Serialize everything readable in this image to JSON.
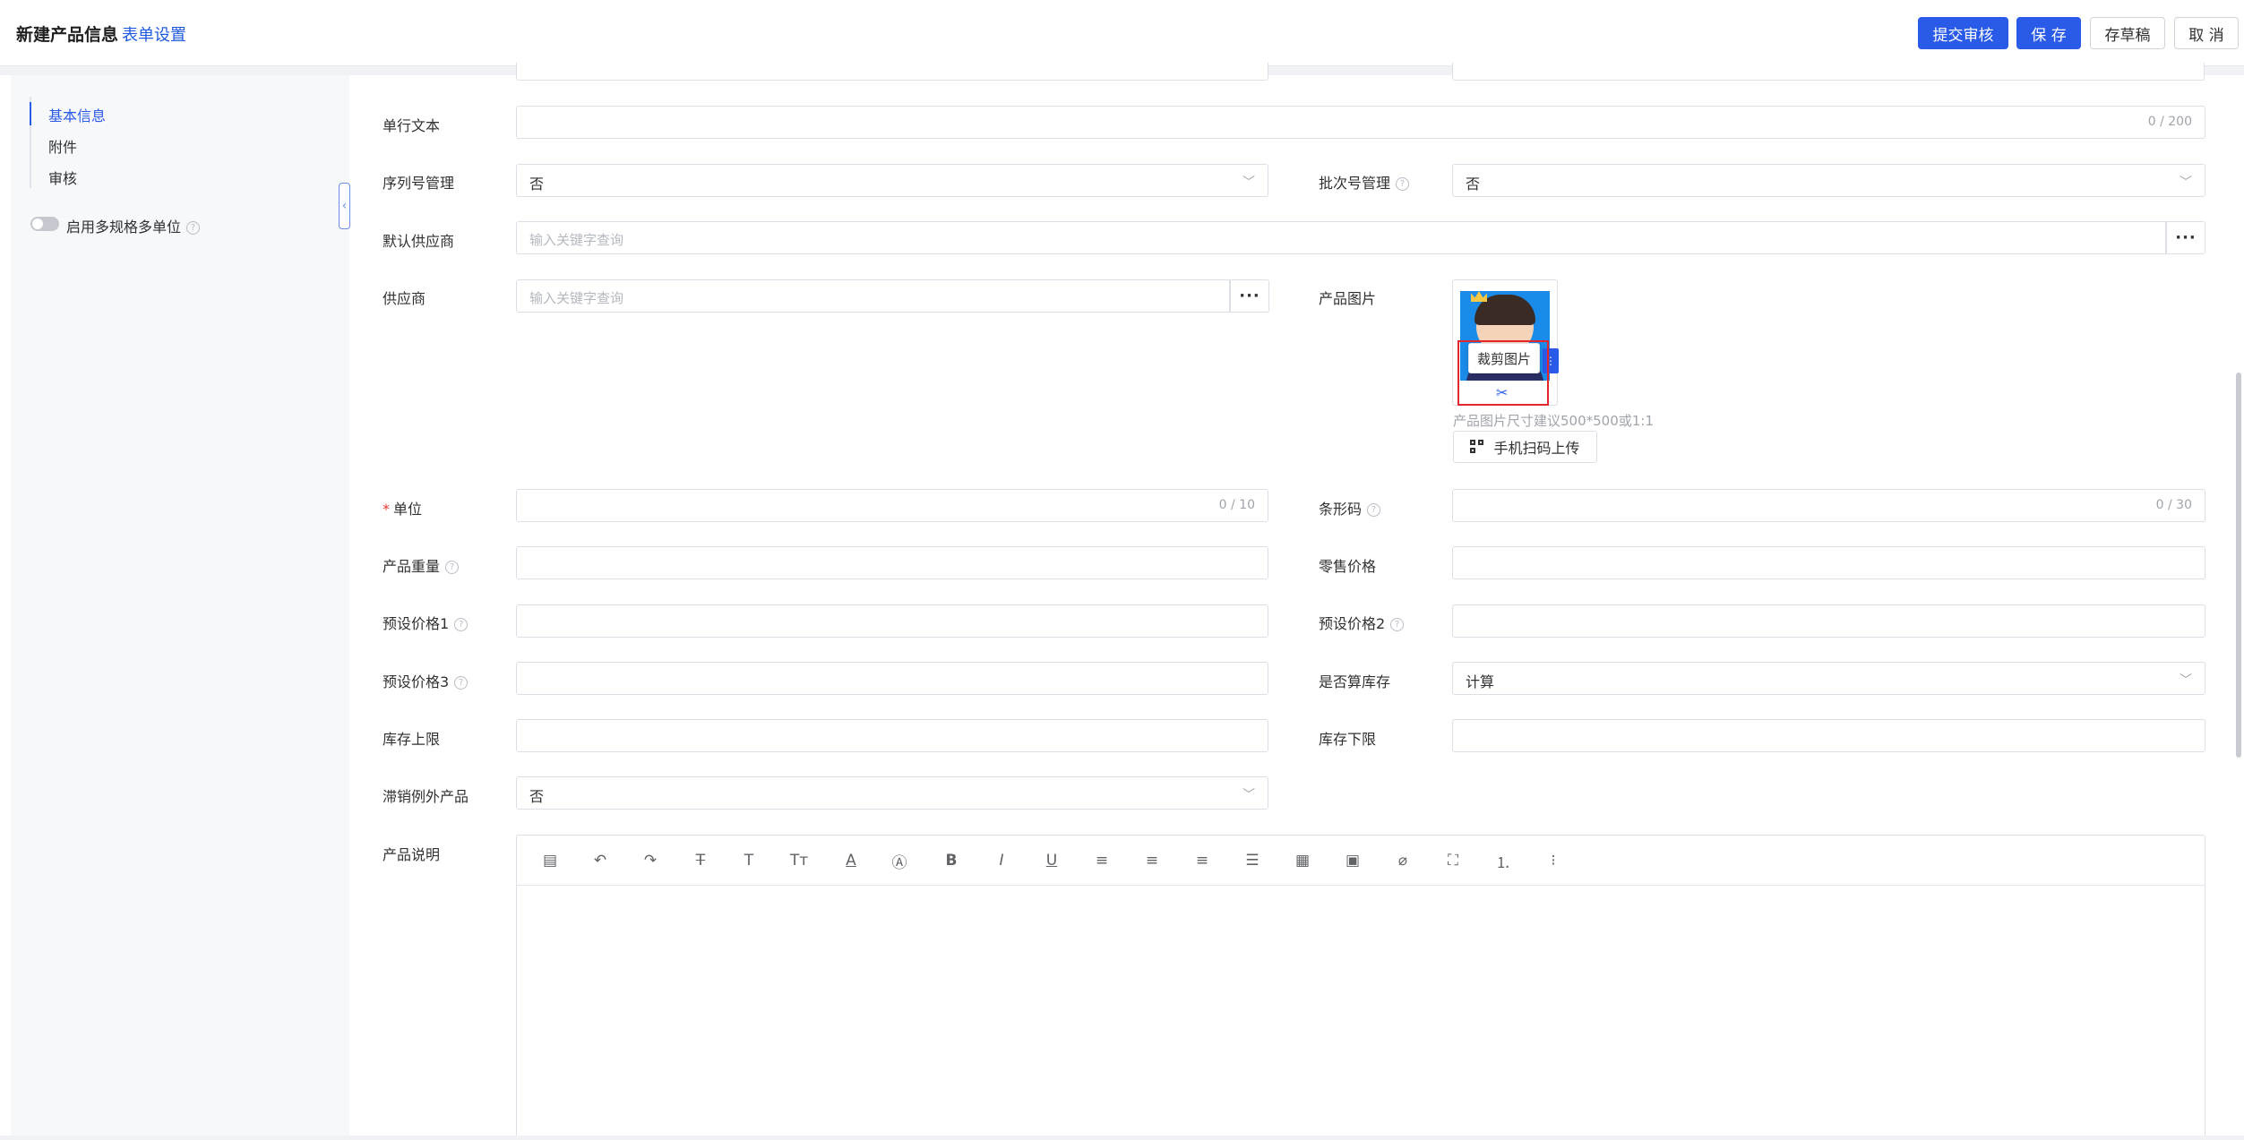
{
  "header": {
    "title": "新建产品信息",
    "form_setting": "表单设置",
    "buttons": {
      "submit": "提交审核",
      "save": "保 存",
      "draft": "存草稿",
      "cancel": "取 消"
    }
  },
  "sidebar": {
    "items": [
      "基本信息",
      "附件",
      "审核"
    ],
    "toggle_label": "启用多规格多单位"
  },
  "form": {
    "single_line_text": {
      "label": "单行文本",
      "counter": "0 / 200"
    },
    "serial_mgmt": {
      "label": "序列号管理",
      "value": "否"
    },
    "batch_mgmt": {
      "label": "批次号管理",
      "value": "否"
    },
    "default_supplier": {
      "label": "默认供应商",
      "placeholder": "输入关键字查询"
    },
    "supplier": {
      "label": "供应商",
      "placeholder": "输入关键字查询"
    },
    "product_image": {
      "label": "产品图片",
      "tooltip": "裁剪图片",
      "hint": "产品图片尺寸建议500*500或1:1",
      "scan_upload": "手机扫码上传"
    },
    "unit": {
      "label": "单位",
      "counter": "0 / 10"
    },
    "barcode": {
      "label": "条形码",
      "counter": "0 / 30"
    },
    "weight": {
      "label": "产品重量"
    },
    "retail_price": {
      "label": "零售价格"
    },
    "preset_price1": {
      "label": "预设价格1"
    },
    "preset_price2": {
      "label": "预设价格2"
    },
    "preset_price3": {
      "label": "预设价格3"
    },
    "count_stock": {
      "label": "是否算库存",
      "value": "计算"
    },
    "stock_upper": {
      "label": "库存上限"
    },
    "stock_lower": {
      "label": "库存下限"
    },
    "slow_exception": {
      "label": "滞销例外产品",
      "value": "否"
    },
    "description": {
      "label": "产品说明"
    }
  },
  "editor_toolbar": [
    "format-icon",
    "undo-icon",
    "redo-icon",
    "strikethrough-icon",
    "font-size-icon",
    "text-size-icon",
    "font-color-icon",
    "background-color-icon",
    "bold-icon",
    "italic-icon",
    "underline-icon",
    "align-left-icon",
    "align-center-icon",
    "align-right-icon",
    "align-justify-icon",
    "table-icon",
    "image-icon",
    "attachment-icon",
    "fullscreen-icon",
    "ordered-list-icon",
    "unordered-list-icon"
  ],
  "colors": {
    "primary": "#2a5ae8",
    "required": "#e53935",
    "highlight": "#e3262e"
  }
}
